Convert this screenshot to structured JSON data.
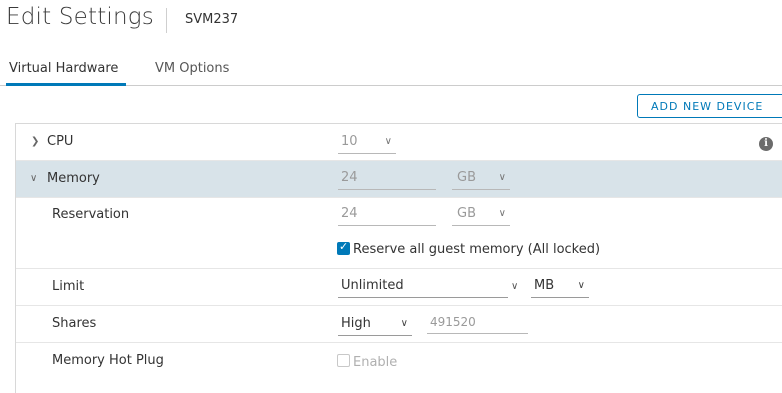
{
  "header": {
    "title": "Edit Settings",
    "vm_name": "SVM237"
  },
  "tabs": [
    {
      "label": "Virtual Hardware",
      "active": true
    },
    {
      "label": "VM Options",
      "active": false
    }
  ],
  "actions": {
    "add_new_device": "ADD NEW DEVICE"
  },
  "hardware": {
    "cpu": {
      "label": "CPU",
      "value": "10",
      "expanded": false
    },
    "memory": {
      "label": "Memory",
      "value": "24",
      "unit": "GB",
      "expanded": true,
      "reservation": {
        "label": "Reservation",
        "value": "24",
        "unit": "GB"
      },
      "reserve_all": {
        "label": "Reserve all guest memory (All locked)",
        "checked": true
      },
      "limit": {
        "label": "Limit",
        "value": "Unlimited",
        "unit": "MB"
      },
      "shares": {
        "label": "Shares",
        "level": "High",
        "value": "491520"
      },
      "hot_plug": {
        "label": "Memory Hot Plug",
        "option": "Enable",
        "checked": false,
        "disabled": true
      }
    }
  },
  "colors": {
    "accent": "#0079b8",
    "selected_row": "#d8e3e9"
  },
  "icons": {
    "collapsed": "chevron-right-icon",
    "expanded": "chevron-down-icon",
    "info": "info-icon"
  }
}
